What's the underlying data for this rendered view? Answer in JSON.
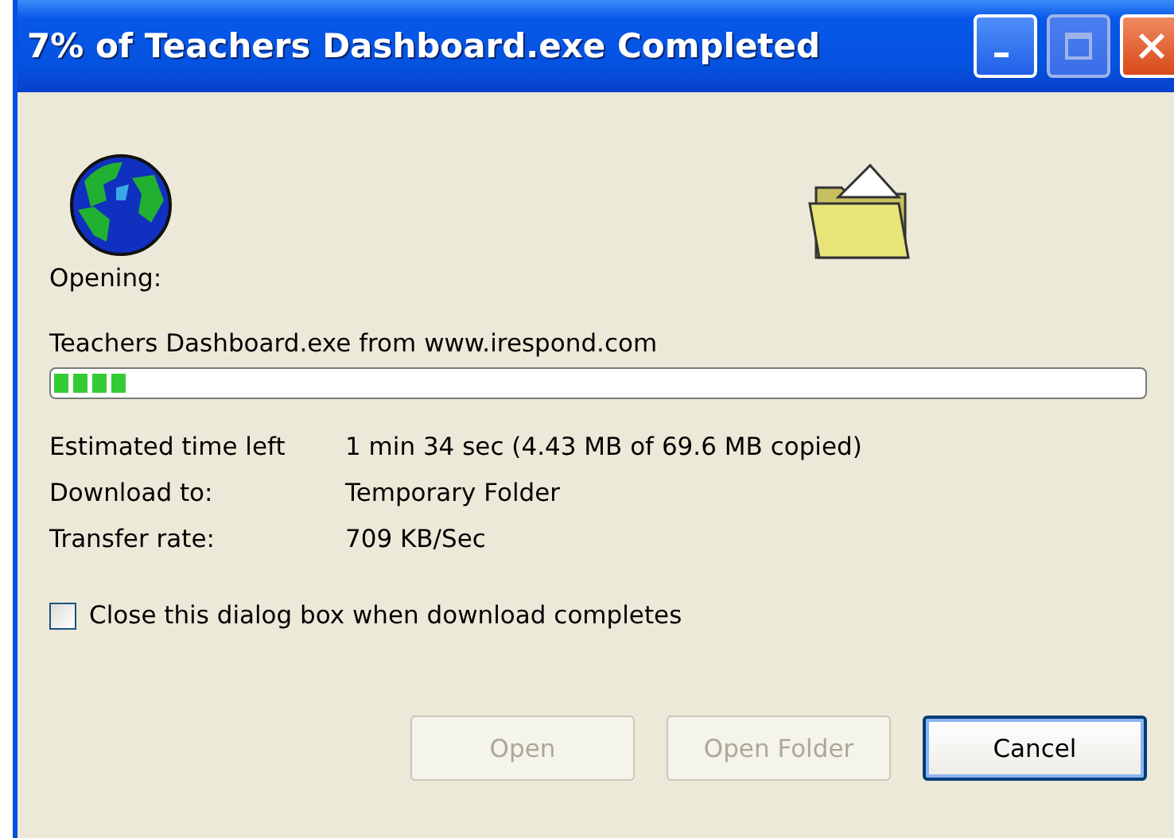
{
  "window": {
    "title": "7% of Teachers Dashboard.exe Completed"
  },
  "status": {
    "label": "Opening:",
    "file": "Teachers Dashboard.exe from www.irespond.com"
  },
  "progress": {
    "level": 0.07
  },
  "details": [
    {
      "label": "Estimated time left",
      "value": "1 min 34 sec (4.43 MB of 69.6 MB copied)"
    },
    {
      "label": "Download to:",
      "value": "Temporary Folder"
    },
    {
      "label": "Transfer rate:",
      "value": "709 KB/Sec"
    }
  ],
  "close_when_done": {
    "label": "Close this dialog box when download completes",
    "checked": false
  },
  "buttons": [
    {
      "label": "Open",
      "disabled": true,
      "default": false
    },
    {
      "label": "Open Folder",
      "disabled": true,
      "default": false
    },
    {
      "label": "Cancel",
      "disabled": false,
      "default": true
    }
  ]
}
